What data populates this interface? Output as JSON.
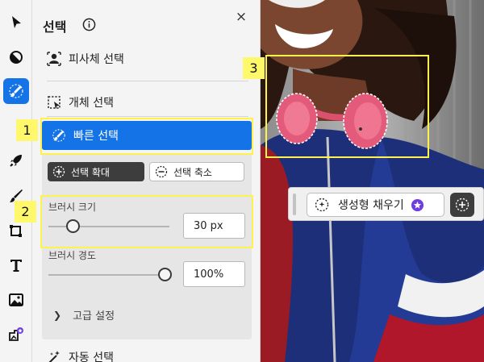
{
  "panel": {
    "title": "선택",
    "close_glyph": "×",
    "menu": {
      "subject_select": "피사체 선택",
      "object_select": "개체 선택",
      "quick_select": "빠른 선택",
      "auto_select": "자동 선택"
    },
    "modes": {
      "add": "선택 확대",
      "subtract": "선택 축소"
    },
    "brush_size": {
      "label": "브러시 크기",
      "value": "30 px",
      "level": 0.2
    },
    "brush_hardness": {
      "label": "브러시 경도",
      "value": "100%",
      "level": 1.0
    },
    "advanced": "고급 설정"
  },
  "floating_bar": {
    "generative_fill": "생성형 채우기"
  },
  "callouts": [
    "1",
    "2",
    "3"
  ],
  "colors": {
    "accent": "#1473e6",
    "highlight": "#fff24a",
    "premium": "#6e3fe0"
  },
  "icons": [
    "select-arrow-icon",
    "adjust-icon",
    "quick-select-brush-icon",
    "rocket-icon",
    "brush-icon",
    "crop-icon",
    "text-icon",
    "image-icon",
    "add-image-icon",
    "info-icon",
    "close-icon",
    "subject-icon",
    "object-select-icon",
    "add-circle-icon",
    "subtract-circle-icon",
    "chevron-right-icon",
    "auto-select-icon",
    "generative-fill-icon",
    "premium-star-icon",
    "plus-icon"
  ]
}
